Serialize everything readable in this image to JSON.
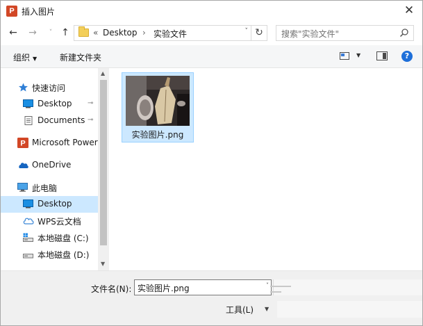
{
  "window": {
    "title": "插入图片",
    "app_icon_letter": "P",
    "close_symbol": "✕"
  },
  "nav": {
    "back_icon": "←",
    "forward_icon": "→",
    "recent_icon": "˅",
    "up_icon": "↑",
    "breadcrumb_overflow": "«",
    "breadcrumb": [
      "Desktop",
      "实验文件"
    ],
    "breadcrumb_separator": "›",
    "address_dropdown_icon": "˅",
    "refresh_icon": "↻",
    "search_placeholder": "搜索\"实验文件\""
  },
  "toolbar": {
    "organize_label": "组织",
    "organize_dropdown": "▼",
    "new_folder_label": "新建文件夹",
    "view_dropdown": "▼",
    "help_label": "?"
  },
  "sidebar": {
    "items": [
      {
        "label": "快速访问",
        "icon": "star-icon"
      },
      {
        "label": "Desktop",
        "icon": "desktop-icon",
        "pinned": true
      },
      {
        "label": "Documents",
        "icon": "document-icon",
        "pinned": true
      },
      {
        "label": "Microsoft PowerPoint",
        "icon": "powerpoint-icon"
      },
      {
        "label": "OneDrive",
        "icon": "cloud-icon"
      },
      {
        "label": "此电脑",
        "icon": "computer-icon"
      },
      {
        "label": "Desktop",
        "icon": "desktop-icon",
        "selected": true
      },
      {
        "label": "WPS云文档",
        "icon": "wps-cloud-icon"
      },
      {
        "label": "本地磁盘 (C:)",
        "icon": "drive-icon"
      },
      {
        "label": "本地磁盘 (D:)",
        "icon": "drive-icon"
      }
    ],
    "pin_symbol": "📌",
    "scroll_up": "▲",
    "scroll_down": "▼"
  },
  "files": [
    {
      "name": "实验图片.png",
      "selected": true
    }
  ],
  "footer": {
    "filename_label": "文件名(N):",
    "filename_value": "实验图片.png",
    "filename_dropdown": "˅",
    "tools_label": "工具(L)",
    "tools_dropdown": "▼"
  },
  "colors": {
    "selection": "#cce8ff",
    "selection_border": "#99d1ff",
    "accent": "#1e6fd9",
    "powerpoint": "#d24726"
  }
}
